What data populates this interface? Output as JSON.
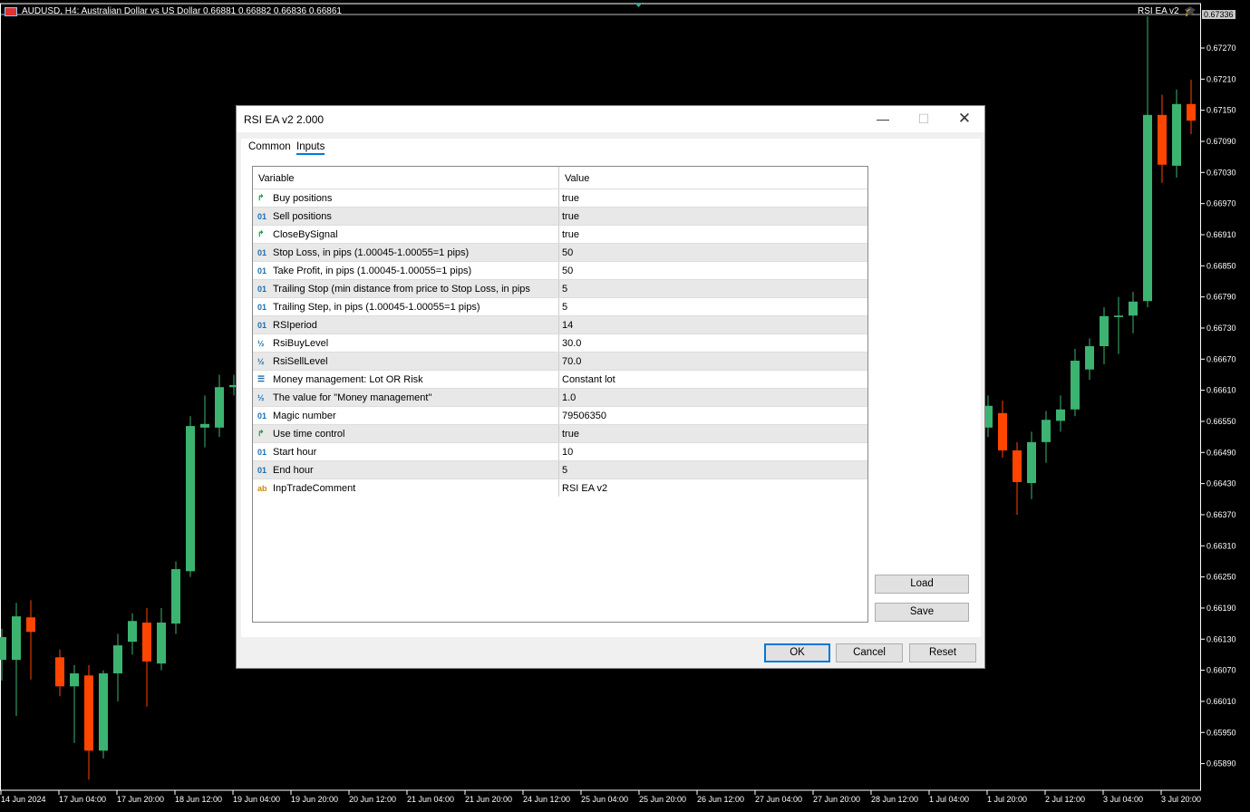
{
  "chart": {
    "symbol_line": "AUDUSD, H4:  Australian Dollar vs US Dollar  0.66881 0.66882 0.66836 0.66861",
    "ea_label": "RSI EA v2",
    "current_price": "0.67336",
    "price_axis": [
      "0.67270",
      "0.67210",
      "0.67150",
      "0.67090",
      "0.67030",
      "0.66970",
      "0.66910",
      "0.66850",
      "0.66790",
      "0.66730",
      "0.66670",
      "0.66610",
      "0.66550",
      "0.66490",
      "0.66430",
      "0.66370",
      "0.66310",
      "0.66250",
      "0.66190",
      "0.66130",
      "0.66070",
      "0.66010",
      "0.65950",
      "0.65890"
    ],
    "time_axis": [
      "14 Jun 2024",
      "17 Jun 04:00",
      "17 Jun 20:00",
      "18 Jun 12:00",
      "19 Jun 04:00",
      "19 Jun 20:00",
      "20 Jun 12:00",
      "21 Jun 04:00",
      "21 Jun 20:00",
      "24 Jun 12:00",
      "25 Jun 04:00",
      "25 Jun 20:00",
      "26 Jun 12:00",
      "27 Jun 04:00",
      "27 Jun 20:00",
      "28 Jun 12:00",
      "1 Jul 04:00",
      "1 Jul 20:00",
      "2 Jul 12:00",
      "3 Jul 04:00",
      "3 Jul 20:00"
    ],
    "colors": {
      "bull": "#3cb371",
      "bear": "#ff4500",
      "background": "#000000"
    },
    "candles": [
      {
        "bar": 0,
        "o": 0.6609,
        "h": 0.6615,
        "l": 0.6605,
        "c": 0.66134
      },
      {
        "bar": 1,
        "o": 0.6609,
        "h": 0.662,
        "l": 0.65982,
        "c": 0.66174
      },
      {
        "bar": 2,
        "o": 0.66172,
        "h": 0.66205,
        "l": 0.66052,
        "c": 0.66144
      },
      {
        "bar": 4,
        "o": 0.66095,
        "h": 0.6611,
        "l": 0.6602,
        "c": 0.66039
      },
      {
        "bar": 5,
        "o": 0.66039,
        "h": 0.6608,
        "l": 0.6593,
        "c": 0.66064
      },
      {
        "bar": 6,
        "o": 0.6606,
        "h": 0.6608,
        "l": 0.65859,
        "c": 0.65915
      },
      {
        "bar": 7,
        "o": 0.65915,
        "h": 0.6607,
        "l": 0.659,
        "c": 0.66064
      },
      {
        "bar": 8,
        "o": 0.66064,
        "h": 0.6614,
        "l": 0.6601,
        "c": 0.66118
      },
      {
        "bar": 9,
        "o": 0.66125,
        "h": 0.6618,
        "l": 0.661,
        "c": 0.66165
      },
      {
        "bar": 10,
        "o": 0.66162,
        "h": 0.6619,
        "l": 0.66,
        "c": 0.66087
      },
      {
        "bar": 11,
        "o": 0.66083,
        "h": 0.6619,
        "l": 0.6607,
        "c": 0.66162
      },
      {
        "bar": 12,
        "o": 0.6616,
        "h": 0.6628,
        "l": 0.6614,
        "c": 0.66265
      },
      {
        "bar": 13,
        "o": 0.66261,
        "h": 0.6656,
        "l": 0.6625,
        "c": 0.66541
      },
      {
        "bar": 14,
        "o": 0.66538,
        "h": 0.666,
        "l": 0.665,
        "c": 0.66545
      },
      {
        "bar": 15,
        "o": 0.66538,
        "h": 0.6664,
        "l": 0.6652,
        "c": 0.66616
      },
      {
        "bar": 16,
        "o": 0.66616,
        "h": 0.6664,
        "l": 0.666,
        "c": 0.6662
      },
      {
        "bar": 68,
        "o": 0.66538,
        "h": 0.666,
        "l": 0.6652,
        "c": 0.6658
      },
      {
        "bar": 69,
        "o": 0.66566,
        "h": 0.6659,
        "l": 0.6648,
        "c": 0.66494
      },
      {
        "bar": 70,
        "o": 0.66494,
        "h": 0.6651,
        "l": 0.6637,
        "c": 0.66433
      },
      {
        "bar": 71,
        "o": 0.66431,
        "h": 0.6653,
        "l": 0.664,
        "c": 0.6651
      },
      {
        "bar": 72,
        "o": 0.6651,
        "h": 0.6657,
        "l": 0.6647,
        "c": 0.66553
      },
      {
        "bar": 73,
        "o": 0.66551,
        "h": 0.666,
        "l": 0.6653,
        "c": 0.66573
      },
      {
        "bar": 74,
        "o": 0.66573,
        "h": 0.6669,
        "l": 0.6656,
        "c": 0.66667
      },
      {
        "bar": 75,
        "o": 0.6665,
        "h": 0.6671,
        "l": 0.6663,
        "c": 0.66695
      },
      {
        "bar": 76,
        "o": 0.66695,
        "h": 0.6677,
        "l": 0.6666,
        "c": 0.66753
      },
      {
        "bar": 77,
        "o": 0.66751,
        "h": 0.6679,
        "l": 0.6668,
        "c": 0.66754
      },
      {
        "bar": 78,
        "o": 0.66754,
        "h": 0.668,
        "l": 0.6672,
        "c": 0.66781
      },
      {
        "bar": 79,
        "o": 0.66782,
        "h": 0.67331,
        "l": 0.6677,
        "c": 0.67141
      },
      {
        "bar": 80,
        "o": 0.67141,
        "h": 0.6718,
        "l": 0.6701,
        "c": 0.67045
      },
      {
        "bar": 81,
        "o": 0.67043,
        "h": 0.6719,
        "l": 0.6702,
        "c": 0.67162
      },
      {
        "bar": 82,
        "o": 0.67162,
        "h": 0.67209,
        "l": 0.67104,
        "c": 0.6713
      }
    ]
  },
  "dialog": {
    "title": "RSI EA v2 2.000",
    "tabs": [
      {
        "label": "Common"
      },
      {
        "label": "Inputs",
        "active": true
      }
    ],
    "columns": [
      "Variable",
      "Value"
    ],
    "rows": [
      {
        "type": "bool",
        "icon": "↱",
        "name": "Buy positions",
        "value": "true"
      },
      {
        "type": "int",
        "icon": "01",
        "name": "Sell positions",
        "value": "true"
      },
      {
        "type": "bool",
        "icon": "↱",
        "name": "CloseBySignal",
        "value": "true"
      },
      {
        "type": "int",
        "icon": "01",
        "name": "Stop Loss, in pips (1.00045-1.00055=1 pips)",
        "value": "50"
      },
      {
        "type": "int",
        "icon": "01",
        "name": "Take Profit, in pips (1.00045-1.00055=1 pips)",
        "value": "50"
      },
      {
        "type": "int",
        "icon": "01",
        "name": "Trailing Stop (min distance from price to Stop Loss, in pips",
        "value": "5"
      },
      {
        "type": "int",
        "icon": "01",
        "name": "Trailing Step, in pips (1.00045-1.00055=1 pips)",
        "value": "5"
      },
      {
        "type": "int",
        "icon": "01",
        "name": "RSIperiod",
        "value": "14"
      },
      {
        "type": "double",
        "icon": "½",
        "name": "RsiBuyLevel",
        "value": "30.0"
      },
      {
        "type": "double",
        "icon": "½",
        "name": "RsiSellLevel",
        "value": "70.0"
      },
      {
        "type": "enum",
        "icon": "☰",
        "name": "Money management: Lot OR Risk",
        "value": "Constant lot"
      },
      {
        "type": "double",
        "icon": "½",
        "name": "The value for \"Money management\"",
        "value": "1.0"
      },
      {
        "type": "int",
        "icon": "01",
        "name": "Magic number",
        "value": "79506350"
      },
      {
        "type": "bool",
        "icon": "↱",
        "name": "Use time control",
        "value": "true"
      },
      {
        "type": "int",
        "icon": "01",
        "name": "Start hour",
        "value": "10"
      },
      {
        "type": "int",
        "icon": "01",
        "name": "End hour",
        "value": "5"
      },
      {
        "type": "string",
        "icon": "ab",
        "name": "InpTradeComment",
        "value": "RSI EA v2"
      }
    ],
    "buttons": {
      "load": "Load",
      "save": "Save",
      "ok": "OK",
      "cancel": "Cancel",
      "reset": "Reset"
    },
    "icon_colors": {
      "bool": "#1a9a3a",
      "int": "#1e6fb0",
      "double": "#1e6fb0",
      "enum": "#1e6fb0",
      "string": "#d08a00"
    }
  }
}
